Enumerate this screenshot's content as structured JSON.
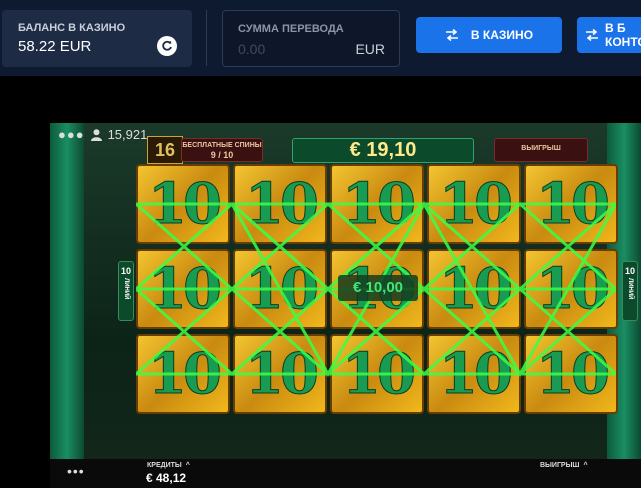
{
  "balance": {
    "label": "БАЛАНС В КАЗИНО",
    "value": "58.22 EUR"
  },
  "transfer": {
    "label": "СУММА ПЕРЕВОДА",
    "placeholder": "0.00",
    "currency": "EUR"
  },
  "buttons": {
    "to_casino": "В КАЗИНО",
    "to_office_line1": "В Б",
    "to_office_line2": "КОНТО"
  },
  "game": {
    "player_count": "15,921",
    "free_spins_label": "БЕСПЛАТНЫЕ СПИНЫ",
    "free_spins_value": "9 / 10",
    "win_label": "ВЫИГРЫШ",
    "total_win": "€ 19,10",
    "center_win": "€ 10,00",
    "lines_count": "10",
    "lines_word": "ЛИНИЙ",
    "logo": "16",
    "symbol": "10"
  },
  "footer": {
    "menu": "•••",
    "credits_label": "КРЕДИТЫ",
    "credits_value": "€ 48,12",
    "win_label": "ВЫИГРЫШ"
  },
  "colors": {
    "accent": "#1a73e8",
    "topbar": "#0d1a30",
    "win_line": "#3bff45"
  }
}
